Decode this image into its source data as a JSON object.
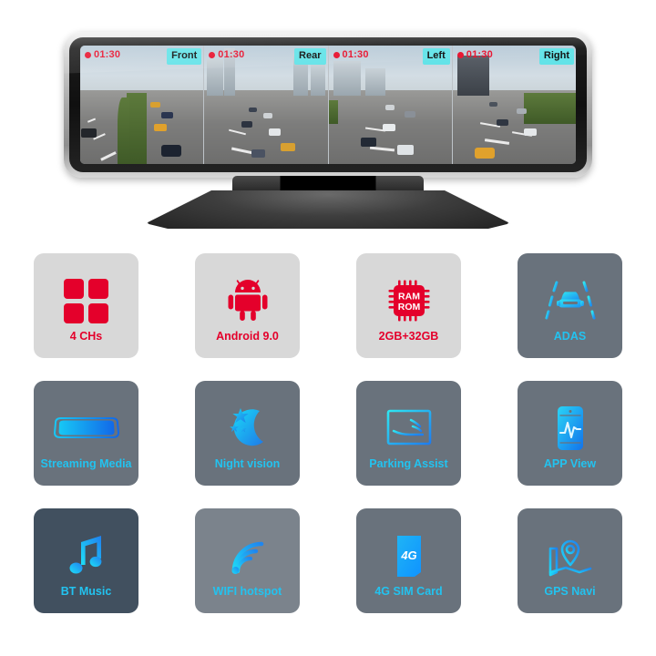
{
  "device": {
    "name": "4-channel rearview mirror dash cam",
    "cameras": [
      {
        "label": "Front",
        "timestamp": "01:30",
        "recording": true
      },
      {
        "label": "Rear",
        "timestamp": "01:30",
        "recording": true
      },
      {
        "label": "Left",
        "timestamp": "01:30",
        "recording": true
      },
      {
        "label": "Right",
        "timestamp": "01:30",
        "recording": true
      }
    ],
    "overlay_colors": {
      "tag_background": "#63e3e8",
      "tag_text": "#111111",
      "recording_text": "#e8112d",
      "recording_dot": "#e8112d"
    }
  },
  "features": [
    {
      "label": "4 CHs",
      "icon": "four-squares-icon",
      "style": "light",
      "accent": "#e4002b"
    },
    {
      "label": "Android 9.0",
      "icon": "android-robot-icon",
      "style": "light",
      "accent": "#e4002b"
    },
    {
      "label": "2GB+32GB",
      "icon": "memory-chip-icon",
      "style": "light",
      "accent": "#e4002b",
      "chip_text_top": "RAM",
      "chip_text_bottom": "ROM"
    },
    {
      "label": "ADAS",
      "icon": "lane-assist-car-icon",
      "style": "slate",
      "accent": "#22c3f0"
    },
    {
      "label": "Streaming Media",
      "icon": "rearview-mirror-icon",
      "style": "slate",
      "accent": "#22c3f0"
    },
    {
      "label": "Night vision",
      "icon": "moon-stars-icon",
      "style": "slate",
      "accent": "#22c3f0"
    },
    {
      "label": "Parking Assist",
      "icon": "parking-screen-icon",
      "style": "slate",
      "accent": "#22c3f0"
    },
    {
      "label": "APP View",
      "icon": "phone-chart-icon",
      "style": "slate",
      "accent": "#22c3f0"
    },
    {
      "label": "BT Music",
      "icon": "music-note-icon",
      "style": "slate-d",
      "accent": "#22c3f0"
    },
    {
      "label": "WIFI hotspot",
      "icon": "wifi-signal-icon",
      "style": "slate-b",
      "accent": "#22c3f0"
    },
    {
      "label": "4G SIM Card",
      "icon": "sim-card-4g-icon",
      "style": "slate",
      "accent": "#22c3f0",
      "sim_text": "4G"
    },
    {
      "label": "GPS Navi",
      "icon": "map-pin-icon",
      "style": "slate",
      "accent": "#22c3f0"
    }
  ]
}
